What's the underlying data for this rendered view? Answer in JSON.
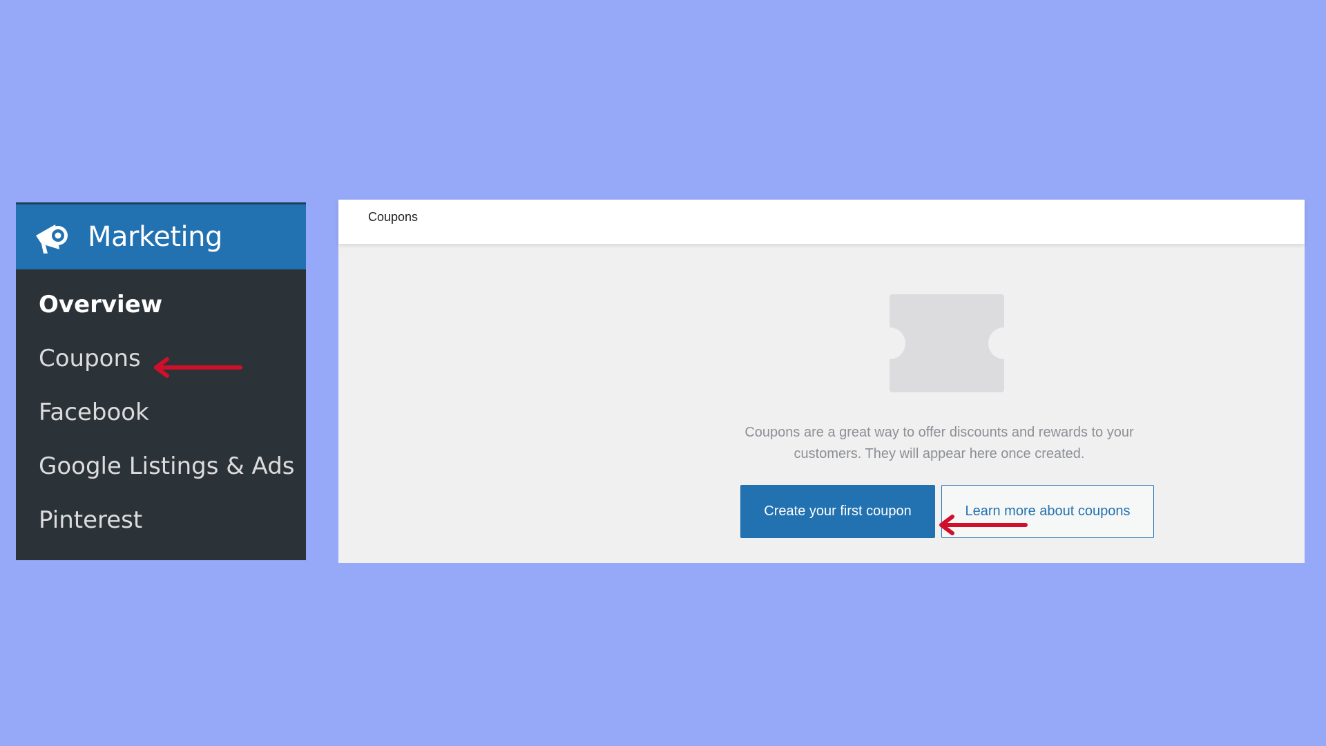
{
  "sidebar": {
    "title": "Marketing",
    "icon": "megaphone-icon",
    "items": [
      {
        "label": "Overview",
        "active": true
      },
      {
        "label": "Coupons",
        "active": false
      },
      {
        "label": "Facebook",
        "active": false
      },
      {
        "label": "Google Listings & Ads",
        "active": false
      },
      {
        "label": "Pinterest",
        "active": false
      }
    ]
  },
  "main": {
    "header_title": "Coupons",
    "empty_state": {
      "illustration": "coupon-icon",
      "message": "Coupons are a great way to offer discounts and rewards to your customers. They will appear here once created."
    },
    "buttons": {
      "primary_label": "Create your first coupon",
      "secondary_label": "Learn more about coupons"
    }
  },
  "colors": {
    "background": "#96a8f8",
    "sidebar_bg": "#2c3338",
    "sidebar_header_bg": "#2271b1",
    "accent": "#2271b1",
    "annotation_arrow": "#d0102a"
  }
}
